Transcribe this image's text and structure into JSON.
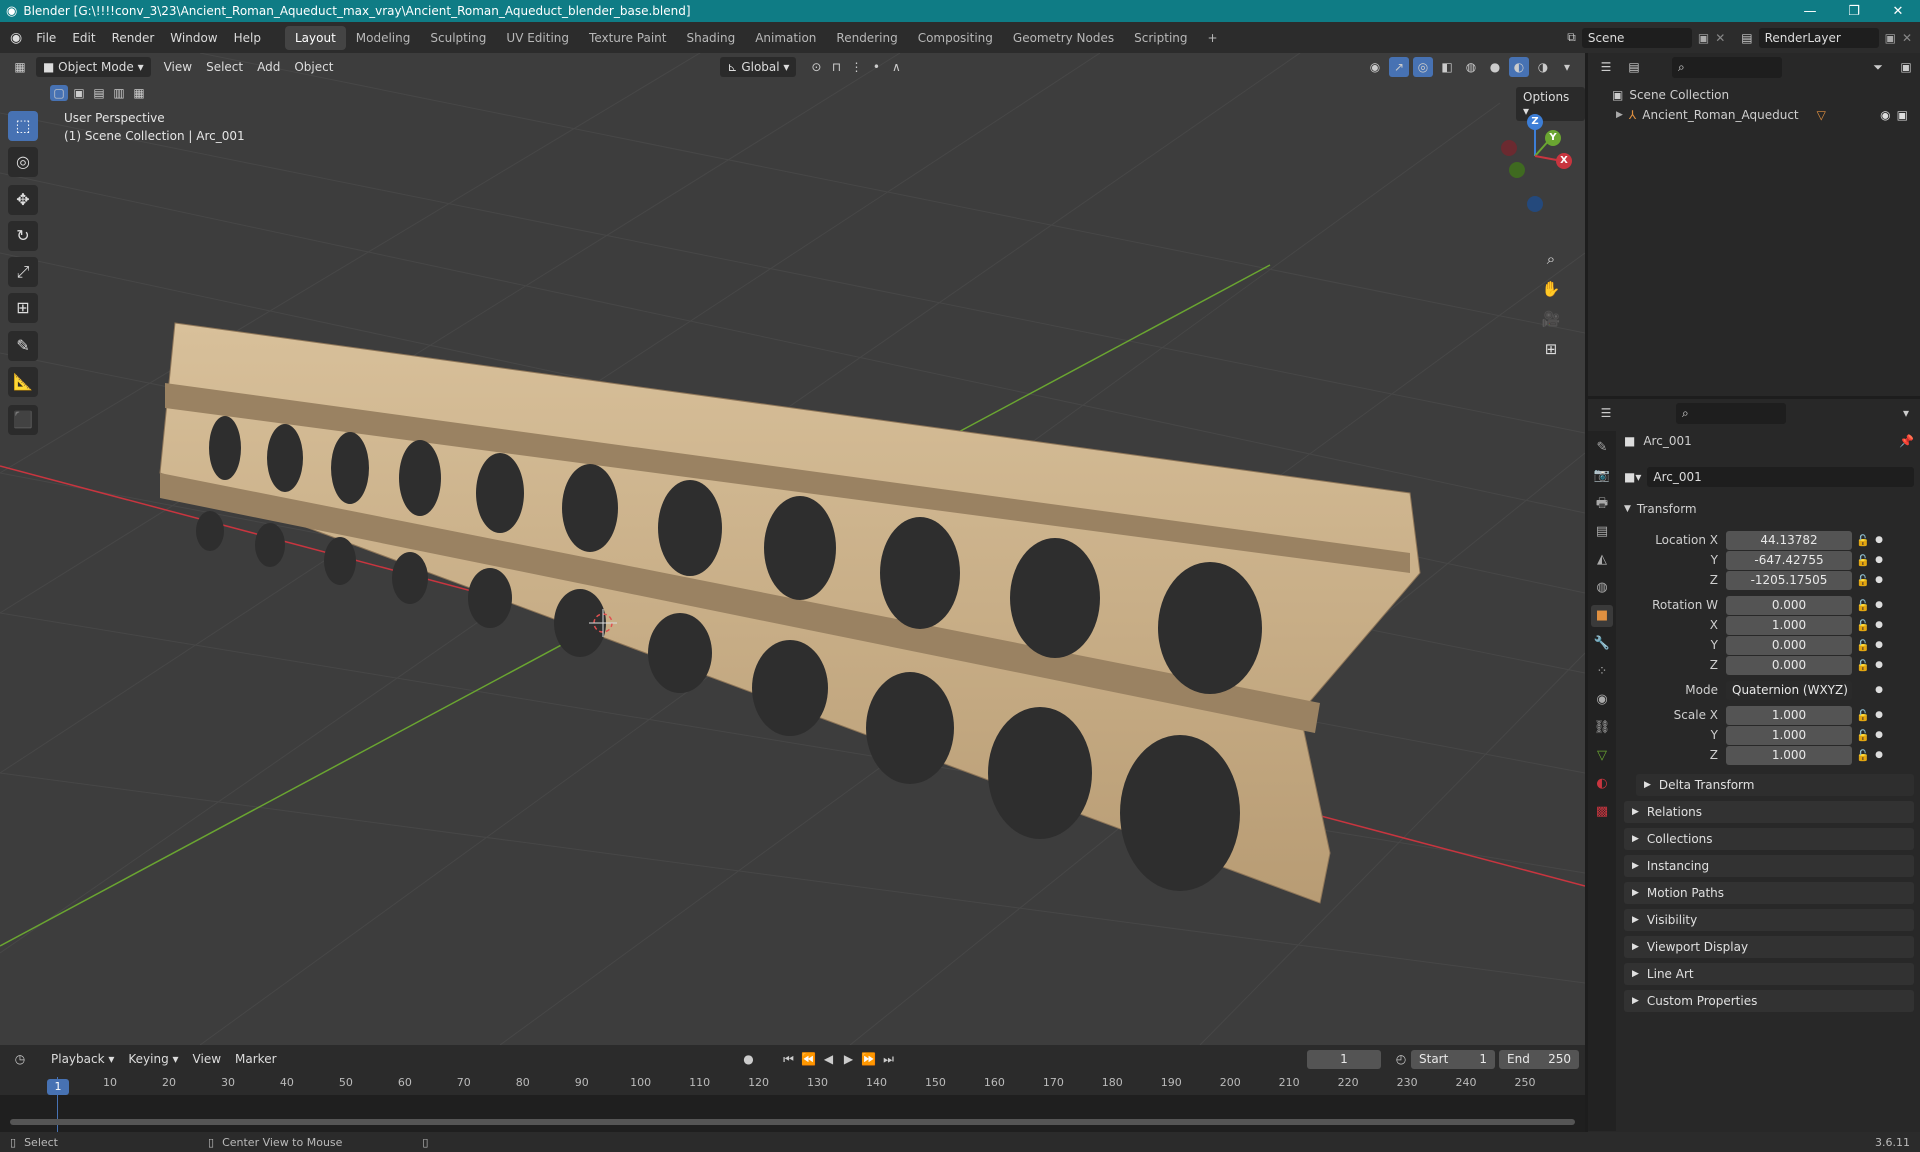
{
  "titlebar": {
    "title": "Blender [G:\\!!!!conv_3\\23\\Ancient_Roman_Aqueduct_max_vray\\Ancient_Roman_Aqueduct_blender_base.blend]",
    "controls": [
      "—",
      "❐",
      "✕"
    ]
  },
  "menu": {
    "items": [
      "File",
      "Edit",
      "Render",
      "Window",
      "Help"
    ],
    "workspaces": [
      "Layout",
      "Modeling",
      "Sculpting",
      "UV Editing",
      "Texture Paint",
      "Shading",
      "Animation",
      "Rendering",
      "Compositing",
      "Geometry Nodes",
      "Scripting"
    ],
    "active_workspace": "Layout",
    "add_tab": "+",
    "scene": "Scene",
    "render_layer": "RenderLayer"
  },
  "viewport": {
    "mode": "Object Mode",
    "menus": [
      "View",
      "Select",
      "Add",
      "Object"
    ],
    "orientation": "Global",
    "options": "Options",
    "info_line1": "User Perspective",
    "info_line2": "(1) Scene Collection | Arc_001",
    "gizmo_axes": [
      "Z",
      "Y",
      "X"
    ]
  },
  "outliner": {
    "root": "Scene Collection",
    "items": [
      {
        "label": "Ancient_Roman_Aqueduct"
      }
    ]
  },
  "properties": {
    "object_name": "Arc_001",
    "datablock_name": "Arc_001",
    "transform_label": "Transform",
    "location": {
      "label_x": "Location X",
      "label_y": "Y",
      "label_z": "Z",
      "x": "44.13782",
      "y": "-647.42755",
      "z": "-1205.17505"
    },
    "rotation": {
      "label_w": "Rotation W",
      "label_x": "X",
      "label_y": "Y",
      "label_z": "Z",
      "w": "0.000",
      "x": "1.000",
      "y": "0.000",
      "z": "0.000"
    },
    "mode_label": "Mode",
    "mode_value": "Quaternion (WXYZ)",
    "scale": {
      "label_x": "Scale X",
      "label_y": "Y",
      "label_z": "Z",
      "x": "1.000",
      "y": "1.000",
      "z": "1.000"
    },
    "delta_transform": "Delta Transform",
    "panels": [
      "Relations",
      "Collections",
      "Instancing",
      "Motion Paths",
      "Visibility",
      "Viewport Display",
      "Line Art",
      "Custom Properties"
    ]
  },
  "timeline": {
    "menus": [
      "Playback",
      "Keying",
      "View",
      "Marker"
    ],
    "current_frame": "1",
    "start_label": "Start",
    "start": "1",
    "end_label": "End",
    "end": "250",
    "ruler": [
      "1",
      "10",
      "20",
      "30",
      "40",
      "50",
      "60",
      "70",
      "80",
      "90",
      "100",
      "110",
      "120",
      "130",
      "140",
      "150",
      "160",
      "170",
      "180",
      "190",
      "200",
      "210",
      "220",
      "230",
      "240",
      "250"
    ]
  },
  "status": {
    "select": "Select",
    "center_view": "Center View to Mouse",
    "version": "3.6.11"
  },
  "colors": {
    "titlebar": "#0f7c85",
    "accent": "#4772b3",
    "x_axis": "#c8353f",
    "y_axis": "#6aa531",
    "z_axis": "#3d7ed6",
    "stone": "#cdb08a"
  }
}
